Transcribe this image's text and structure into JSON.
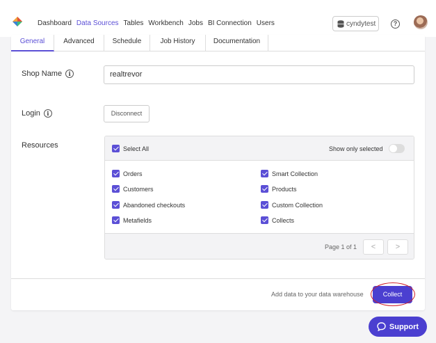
{
  "nav": {
    "items": [
      "Dashboard",
      "Data Sources",
      "Tables",
      "Workbench",
      "Jobs",
      "BI Connection",
      "Users"
    ],
    "active": "Data Sources",
    "user": "cyndytest"
  },
  "tabs": [
    "General",
    "Advanced",
    "Schedule",
    "Job History",
    "Documentation"
  ],
  "form": {
    "shop_name_label": "Shop Name",
    "shop_name_value": "realtrevor",
    "login_label": "Login",
    "disconnect_label": "Disconnect",
    "resources_label": "Resources"
  },
  "resources": {
    "select_all": "Select All",
    "show_only_selected": "Show only selected",
    "items_left": [
      "Orders",
      "Customers",
      "Abandoned checkouts",
      "Metafields"
    ],
    "items_right": [
      "Smart Collection",
      "Products",
      "Custom Collection",
      "Collects"
    ],
    "page_text": "Page 1 of 1",
    "prev": "<",
    "next": ">"
  },
  "footer": {
    "add_text": "Add data to your data warehouse",
    "collect_label": "Collect"
  },
  "support_label": "Support",
  "colors": {
    "accent": "#5b4fd6",
    "button": "#4b3fd0",
    "highlight_ring": "#d0202a"
  }
}
